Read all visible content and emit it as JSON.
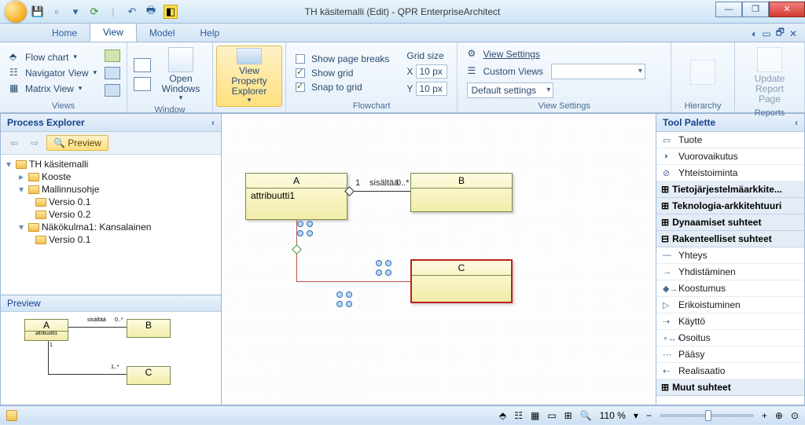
{
  "title": "TH käsitemalli (Edit) - QPR EnterpriseArchitect",
  "tabs": {
    "home": "Home",
    "view": "View",
    "model": "Model",
    "help": "Help"
  },
  "ribbon": {
    "views_group": "Views",
    "flowchart_btn": "Flow chart",
    "navigator_btn": "Navigator View",
    "matrix_btn": "Matrix View",
    "window_group": "Window",
    "open_windows": "Open Windows",
    "view_prop": "View Property Explorer",
    "flowchart_group": "Flowchart",
    "show_breaks": "Show page breaks",
    "show_grid": "Show grid",
    "snap_grid": "Snap to grid",
    "grid_size": "Grid size",
    "grid_x": "X",
    "grid_x_val": "10 px",
    "grid_y": "Y",
    "grid_y_val": "10 px",
    "viewsettings_group": "View Settings",
    "view_settings": "View Settings",
    "custom_views": "Custom Views",
    "default_settings": "Default settings",
    "hierarchy_group": "Hierarchy",
    "reports_group": "Reports",
    "update_report": "Update Report Page"
  },
  "explorer": {
    "title": "Process Explorer",
    "preview_btn": "Preview",
    "root": "TH käsitemalli",
    "items": [
      "Kooste",
      "Mallinnusohje",
      "Versio 0.1",
      "Versio 0.2",
      "Näkökulma1: Kansalainen",
      "Versio 0.1"
    ],
    "preview_label": "Preview"
  },
  "canvas": {
    "class_a": "A",
    "attr_a": "attribuutti1",
    "class_b": "B",
    "class_c": "C",
    "rel": "sisältää",
    "mult0": "0..*",
    "mult1": "1"
  },
  "palette": {
    "title": "Tool Palette",
    "items_top": [
      "Tuote",
      "Vuorovaikutus",
      "Yhteistoiminta"
    ],
    "groups": [
      "Tietojärjestelmäarkkite...",
      "Teknologia-arkkitehtuuri",
      "Dynaamiset suhteet",
      "Rakenteelliset suhteet"
    ],
    "items_rel": [
      "Yhteys",
      "Yhdistäminen",
      "Koostumus",
      "Erikoistuminen",
      "Käyttö",
      "Osoitus",
      "Pääsy",
      "Realisaatio"
    ],
    "last_group": "Muut suhteet"
  },
  "status": {
    "zoom": "110 %"
  },
  "mini": {
    "a": "A",
    "attr": "attribuutti1",
    "b": "B",
    "c": "C",
    "rel": "sisältää",
    "m0": "0..*",
    "m1": "1",
    "m1b": "1..*"
  }
}
